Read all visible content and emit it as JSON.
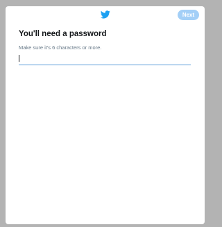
{
  "header": {
    "logo_icon": "twitter-bird-icon",
    "next_label": "Next"
  },
  "main": {
    "title": "You'll need a password",
    "subtitle": "Make sure it's 6 characters or more.",
    "password_value": "",
    "password_placeholder": ""
  },
  "colors": {
    "brand": "#1da1f2",
    "next_button_disabled": "#a3cff7",
    "input_underline": "#5b9bd9",
    "backdrop": "#b3b3b3"
  }
}
